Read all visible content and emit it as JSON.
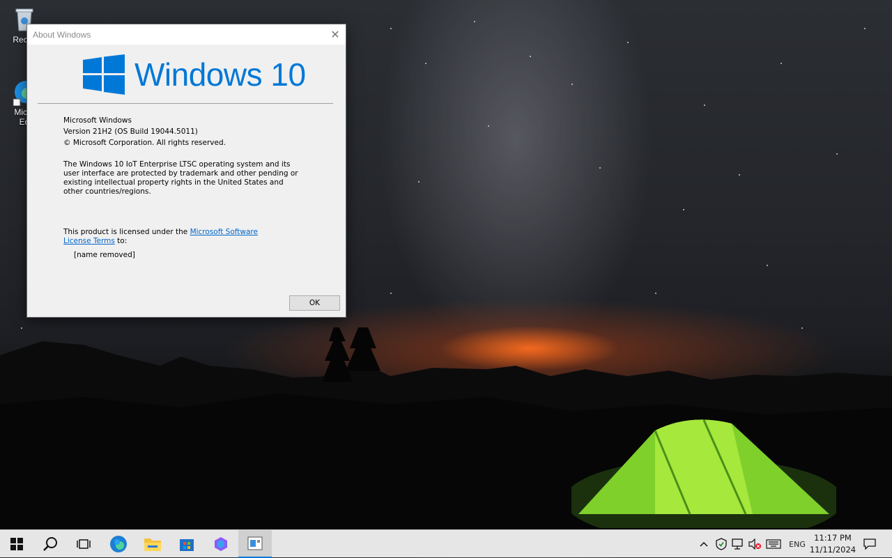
{
  "desktop": {
    "icons": [
      {
        "label": "Recyc",
        "icon": "recycle-bin-icon"
      },
      {
        "label_line1": "Micro",
        "label_line2": "Ed",
        "icon": "edge-icon"
      }
    ]
  },
  "dialog": {
    "title": "About Windows",
    "close_glyph": "✕",
    "logo_text": "Windows 10",
    "product": "Microsoft Windows",
    "version": "Version 21H2 (OS Build 19044.5011)",
    "copyright": "© Microsoft Corporation. All rights reserved.",
    "legal": "The Windows 10 IoT Enterprise LTSC operating system and its user interface are protected by trademark and other pending or existing intellectual property rights in the United States and other countries/regions.",
    "license_prefix": "This product is licensed under the ",
    "license_link": "Microsoft Software License Terms",
    "license_suffix": " to:",
    "licensed_to": "[name removed]",
    "ok_label": "OK"
  },
  "taskbar": {
    "apps": [
      "start-icon",
      "search-icon",
      "task-view-icon",
      "edge-icon",
      "file-explorer-icon",
      "store-icon",
      "copilot-icon",
      "winver-icon"
    ],
    "active_app": "winver-icon",
    "language": "ENG",
    "time": "11:17 PM",
    "date": "11/11/2024",
    "accent": "#0078d7"
  }
}
